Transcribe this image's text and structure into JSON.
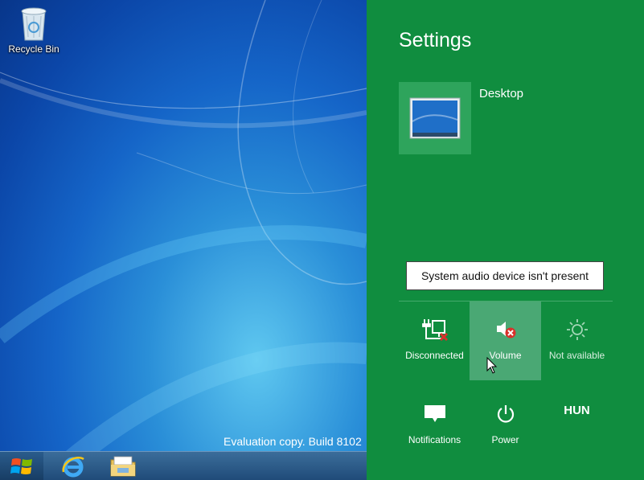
{
  "desktop": {
    "recycle_bin_label": "Recycle Bin",
    "watermark": "Evaluation copy. Build 8102"
  },
  "taskbar": {
    "items": [
      "start-orb",
      "internet-explorer",
      "file-explorer"
    ]
  },
  "charm": {
    "title": "Settings",
    "tile_label": "Desktop",
    "tooltip": "System audio device isn't present",
    "quick_settings": [
      {
        "label": "Disconnected",
        "icon": "network-disconnected-icon"
      },
      {
        "label": "Volume",
        "icon": "volume-muted-icon"
      },
      {
        "label": "Not available",
        "icon": "brightness-icon"
      },
      {
        "label": "Notifications",
        "icon": "notifications-icon"
      },
      {
        "label": "Power",
        "icon": "power-icon"
      },
      {
        "label": "HUN",
        "icon": "keyboard-language"
      }
    ]
  },
  "colors": {
    "charm_bg": "#108d3f",
    "tile_bg": "#2ea45c",
    "hover_bg": "#4aa874",
    "error_red": "#d9312b"
  }
}
